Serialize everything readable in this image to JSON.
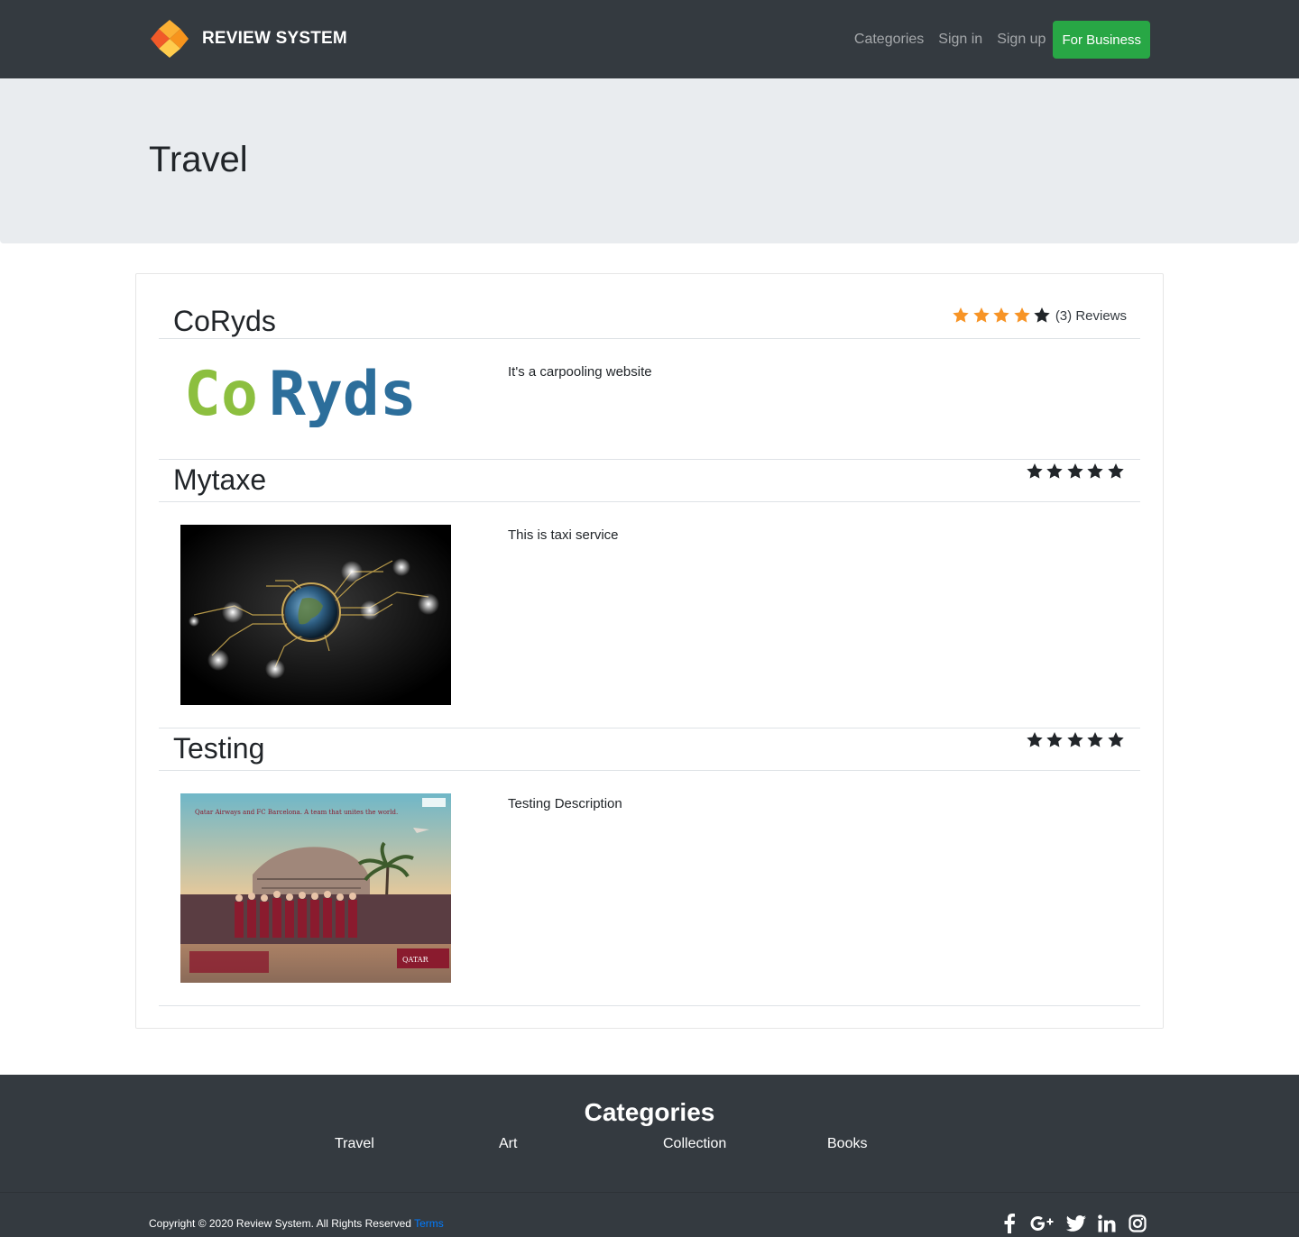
{
  "navbar": {
    "brand": "REVIEW SYSTEM",
    "links": [
      "Categories",
      "Sign in",
      "Sign up"
    ],
    "business_button": "For Business"
  },
  "jumbotron": {
    "title": "Travel"
  },
  "items": [
    {
      "name": "CoRyds",
      "rating": 4,
      "max_rating": 5,
      "reviews_count_label": "(3) Reviews",
      "description": "It's a carpooling website",
      "logo_text": "CoRyds"
    },
    {
      "name": "Mytaxe",
      "rating": 0,
      "max_rating": 5,
      "description": "This is taxi service"
    },
    {
      "name": "Testing",
      "rating": 0,
      "max_rating": 5,
      "description": "Testing Description",
      "image_caption": "Qatar Airways and FC Barcelona. A team that unites the world.",
      "image_brand": "QATAR"
    }
  ],
  "footer": {
    "title": "Categories",
    "categories": [
      "Travel",
      "Art",
      "Collection",
      "Books"
    ],
    "copyright": "Copyright © 2020 Review System. All Rights Reserved",
    "terms_label": "Terms",
    "socials": [
      "facebook-icon",
      "google-plus-icon",
      "twitter-icon",
      "linkedin-icon",
      "instagram-icon"
    ]
  },
  "colors": {
    "navbar_bg": "#343a40",
    "business_green": "#28a745",
    "star_filled": "#f79426",
    "star_empty": "#212529",
    "jumbotron_bg": "#e9ecef",
    "link_blue": "#007bff"
  }
}
